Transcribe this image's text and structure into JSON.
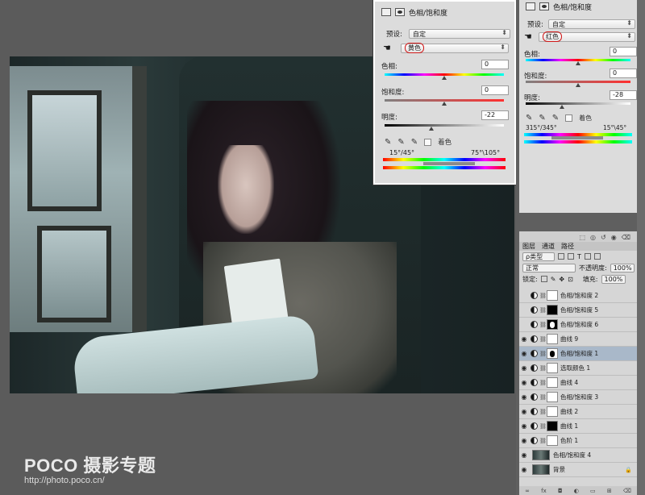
{
  "dialog": {
    "title": "色相/饱和度",
    "preset_label": "预设:",
    "preset_value": "自定",
    "channel_value": "黄色",
    "hue_label": "色相:",
    "hue_value": "0",
    "hue_fraction": 0.5,
    "sat_label": "饱和度:",
    "sat_value": "0",
    "sat_fraction": 0.5,
    "light_label": "明度:",
    "light_value": "-22",
    "light_fraction": 0.39,
    "colorize_label": "着色",
    "range_left": "15°/45°",
    "range_right": "75°\\105°"
  },
  "properties": {
    "title": "色相/饱和度",
    "preset_label": "预设:",
    "preset_value": "自定",
    "channel_value": "红色",
    "hue_label": "色相:",
    "hue_value": "0",
    "sat_label": "饱和度:",
    "sat_value": "0",
    "light_label": "明度:",
    "light_value": "-28",
    "colorize_label": "着色",
    "range_left": "315°/345°",
    "range_right": "15°\\45°"
  },
  "layers_panel": {
    "tabs": [
      "图层",
      "通道",
      "路径"
    ],
    "filter_label": "ρ类型",
    "blend_mode": "正常",
    "opacity_label": "不透明度:",
    "opacity_value": "100%",
    "lock_label": "锁定:",
    "fill_label": "填充:",
    "fill_value": "100%",
    "layers": [
      {
        "name": "色相/饱和度 2",
        "type": "adj",
        "mask": "white",
        "visible": false
      },
      {
        "name": "色相/饱和度 5",
        "type": "adj",
        "mask": "black",
        "visible": false
      },
      {
        "name": "色相/饱和度 6",
        "type": "adj",
        "mask": "blackfig",
        "visible": false
      },
      {
        "name": "曲线 9",
        "type": "curve",
        "mask": "white",
        "visible": true
      },
      {
        "name": "色相/饱和度 1",
        "type": "adj",
        "mask": "whitefig",
        "visible": true
      },
      {
        "name": "选取颜色 1",
        "type": "adj",
        "mask": "white",
        "visible": true
      },
      {
        "name": "曲线 4",
        "type": "curve",
        "mask": "white",
        "visible": true
      },
      {
        "name": "色相/饱和度 3",
        "type": "adj",
        "mask": "white",
        "visible": true
      },
      {
        "name": "曲线 2",
        "type": "curve",
        "mask": "white",
        "visible": true
      },
      {
        "name": "曲线 1",
        "type": "curve",
        "mask": "black",
        "visible": true
      },
      {
        "name": "色阶 1",
        "type": "adj",
        "mask": "white",
        "visible": true
      },
      {
        "name": "色相/饱和度 4",
        "type": "adj",
        "mask": "photo",
        "visible": true
      },
      {
        "name": "背景",
        "type": "bg",
        "mask": "photo",
        "visible": true
      }
    ]
  },
  "watermark": {
    "title": "POCO 摄影专题",
    "url": "http://photo.poco.cn/"
  }
}
